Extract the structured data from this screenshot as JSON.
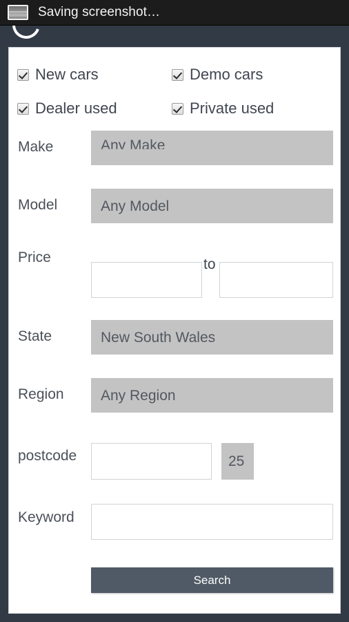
{
  "status_bar": {
    "icon": "screenshot-image-icon",
    "text": "Saving screenshot…",
    "spinner": "loading-spinner-icon",
    "background_color": "#1c1c1c",
    "text_color": "#f4f4f4"
  },
  "page": {
    "background_color": "#313a45",
    "card_background": "#ffffff"
  },
  "form": {
    "checkboxes": [
      {
        "label": "New cars",
        "checked": true
      },
      {
        "label": "Demo cars",
        "checked": true
      },
      {
        "label": "Dealer used",
        "checked": true
      },
      {
        "label": "Private used",
        "checked": true
      }
    ],
    "make": {
      "label": "Make",
      "value": "Any Make",
      "options": [
        "Any Make"
      ]
    },
    "model": {
      "label": "Model",
      "value": "Any Model",
      "options": [
        "Any Model"
      ]
    },
    "price": {
      "label": "Price",
      "separator": "to",
      "min_value": "",
      "max_value": "",
      "min_placeholder": "",
      "max_placeholder": ""
    },
    "state": {
      "label": "State",
      "value": "New South Wales",
      "options": [
        "New South Wales"
      ]
    },
    "region": {
      "label": "Region",
      "value": "Any Region",
      "options": [
        "Any Region"
      ]
    },
    "postcode": {
      "label": "postcode",
      "value": "",
      "placeholder": "",
      "radius_value": "25",
      "radius_options": [
        "25"
      ]
    },
    "keyword": {
      "label": "Keyword",
      "value": "",
      "placeholder": ""
    },
    "search_button": {
      "label": "Search",
      "background_color": "#505a66",
      "text_color": "#ffffff"
    }
  }
}
